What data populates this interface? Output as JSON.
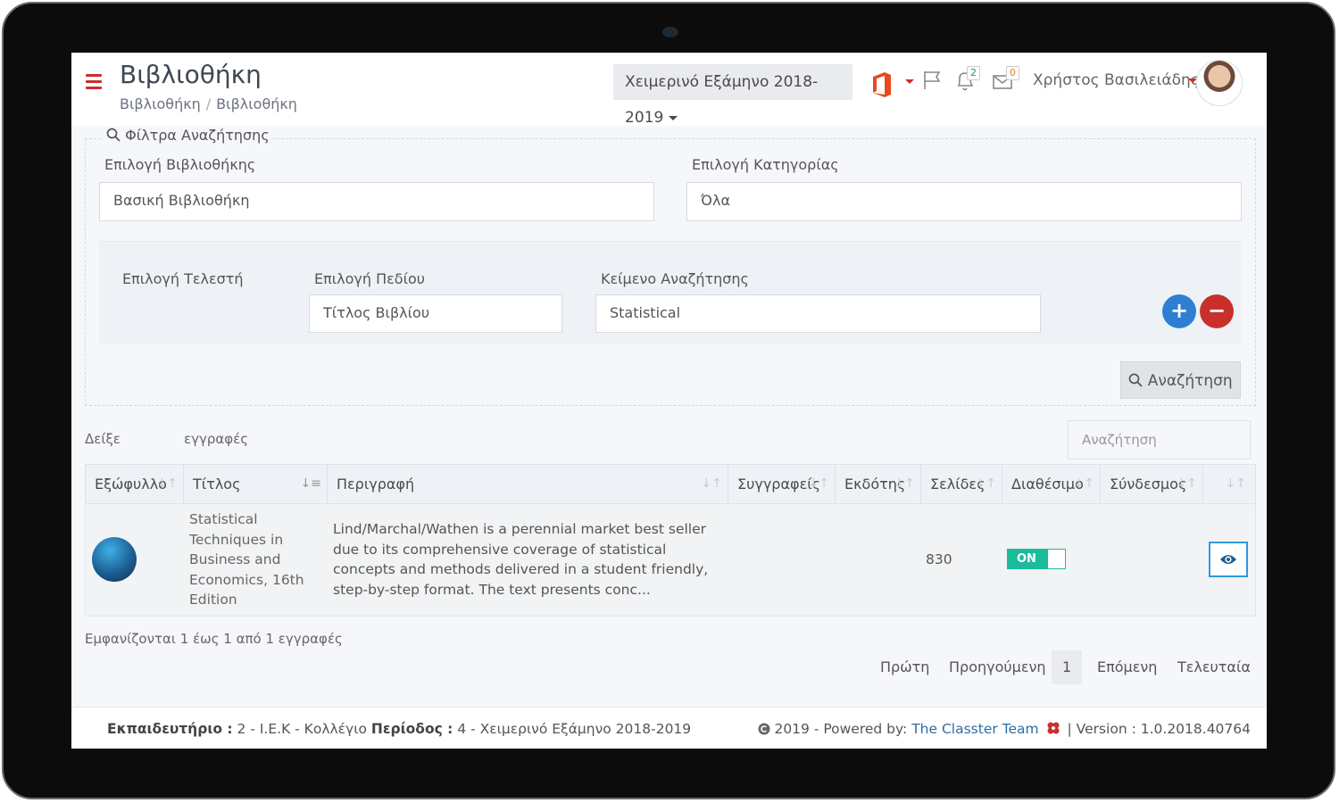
{
  "header": {
    "title": "Βιβλιοθήκη",
    "breadcrumb": [
      "Βιβλιοθήκη",
      "Βιβλιοθήκη"
    ],
    "semester": "Χειμερινό Εξάμηνο 2018-2019",
    "notifications_count": "2",
    "messages_count": "0",
    "user_name": "Χρήστος Βασιλειάδης"
  },
  "filters": {
    "legend": "Φίλτρα Αναζήτησης",
    "library_label": "Επιλογή Βιβλιοθήκης",
    "library_value": "Βασική Βιβλιοθήκη",
    "category_label": "Επιλογή Κατηγορίας",
    "category_value": "Όλα",
    "operator_label": "Επιλογή Τελεστή",
    "field_label": "Επιλογή Πεδίου",
    "field_value": "Τίτλος Βιβλίου",
    "text_label": "Κείμενο Αναζήτησης",
    "text_value": "Statistical",
    "add_symbol": "+",
    "remove_symbol": "−",
    "search_button": "Αναζήτηση"
  },
  "table_controls": {
    "show_label": "Δείξε",
    "records_label": "εγγραφές",
    "search_placeholder": "Αναζήτηση"
  },
  "table": {
    "columns": [
      "Εξώφυλλο",
      "Τίτλος",
      "Περιγραφή",
      "Συγγραφείς",
      "Εκδότης",
      "Σελίδες",
      "Διαθέσιμο",
      "Σύνδεσμος",
      ""
    ],
    "rows": [
      {
        "title": "Statistical Techniques in Business and Economics, 16th Edition",
        "description": "Lind/Marchal/Wathen is a perennial market best seller due to its comprehensive coverage of statistical concepts and methods delivered in a student friendly, step-by-step format. The text presents conc...",
        "authors": "",
        "publisher": "",
        "pages": "830",
        "available": "ON",
        "link": ""
      }
    ]
  },
  "info": "Εμφανίζονται 1 έως 1 από 1 εγγραφές",
  "pagination": {
    "first": "Πρώτη",
    "previous": "Προηγούμενη",
    "current": "1",
    "next": "Επόμενη",
    "last": "Τελευταία"
  },
  "footer": {
    "school_key": "Εκπαιδευτήριο :",
    "school_value": "2 - I.E.K - Κολλέγιο",
    "period_key": "Περίοδος :",
    "period_value": "4 - Χειμερινό Εξάμηνο 2018-2019",
    "copyright": "2019 - Powered by:",
    "team": "The Classter Team",
    "version": "| Version : 1.0.2018.40764"
  },
  "colors": {
    "accent_red": "#c9302c",
    "accent_blue": "#3498db",
    "toggle_green": "#1abc9c"
  }
}
